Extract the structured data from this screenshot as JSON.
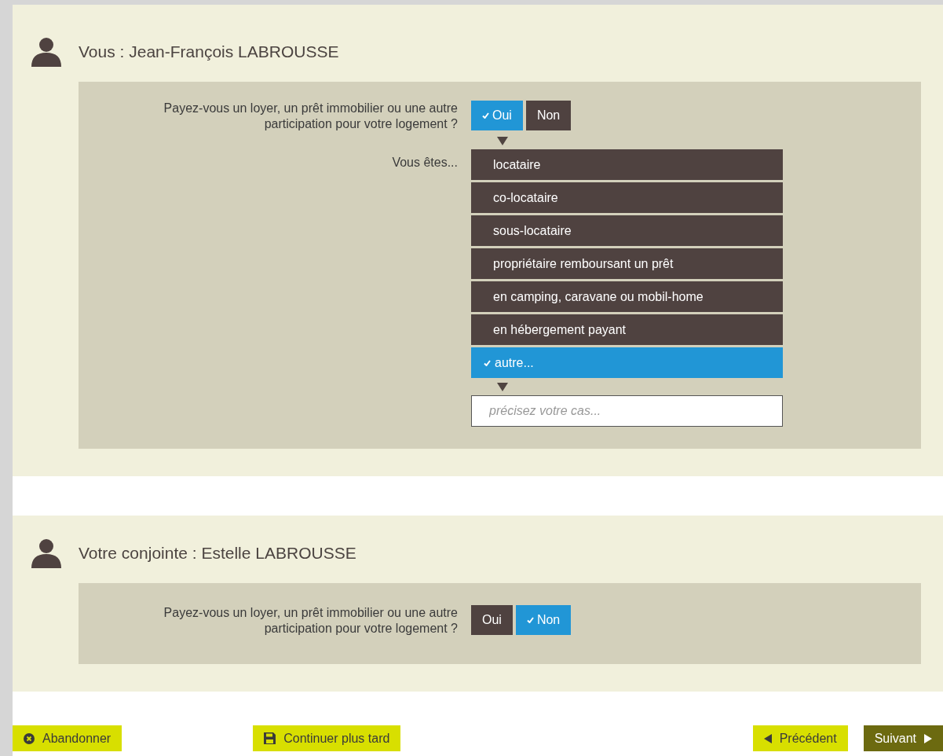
{
  "sections": [
    {
      "title": "Vous : Jean-François LABROUSSE",
      "question": "Payez-vous un loyer, un prêt immobilier ou une autre participation pour votre logement ?",
      "answers": [
        {
          "label": "Oui",
          "selected": true
        },
        {
          "label": "Non",
          "selected": false
        }
      ],
      "status_label": "Vous êtes...",
      "statuses": [
        {
          "label": "locataire",
          "selected": false
        },
        {
          "label": "co-locataire",
          "selected": false
        },
        {
          "label": "sous-locataire",
          "selected": false
        },
        {
          "label": "propriétaire remboursant un prêt",
          "selected": false
        },
        {
          "label": "en camping, caravane ou mobil-home",
          "selected": false
        },
        {
          "label": "en hébergement payant",
          "selected": false
        },
        {
          "label": "autre...",
          "selected": true
        }
      ],
      "detail": {
        "placeholder": "précisez votre cas..."
      }
    },
    {
      "title": "Votre conjointe : Estelle LABROUSSE",
      "question": "Payez-vous un loyer, un prêt immobilier ou une autre participation pour votre logement ?",
      "answers": [
        {
          "label": "Oui",
          "selected": false
        },
        {
          "label": "Non",
          "selected": true
        }
      ]
    }
  ],
  "footer": [
    {
      "kind": "cancel",
      "label": "Abandonner"
    },
    {
      "kind": "save",
      "label": "Continuer plus tard"
    },
    {
      "kind": "previous",
      "label": "Précédent"
    },
    {
      "kind": "next",
      "label": "Suivant"
    }
  ]
}
